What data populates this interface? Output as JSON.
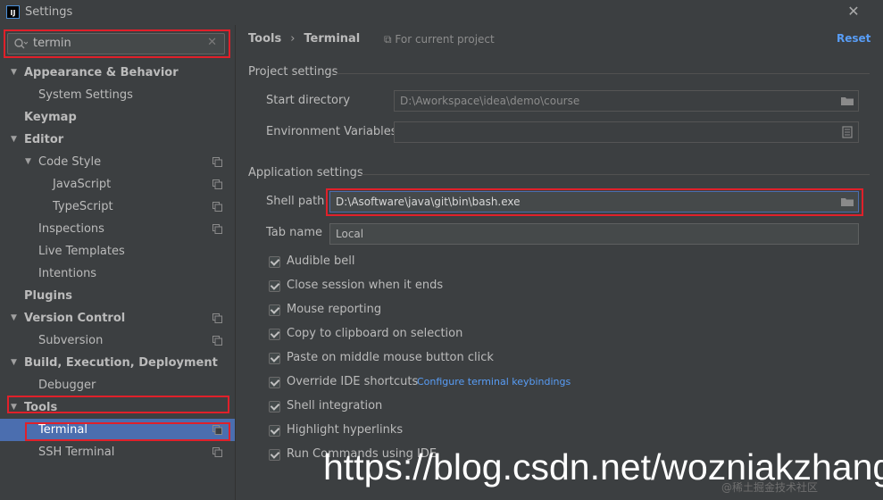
{
  "window": {
    "title": "Settings",
    "icon_text": "IJ"
  },
  "search": {
    "value": "termin",
    "placeholder": ""
  },
  "sidebar": {
    "items": [
      {
        "label": "Appearance & Behavior",
        "level": 0,
        "bold": true,
        "expanded": true
      },
      {
        "label": "System Settings",
        "level": 1,
        "bold": false
      },
      {
        "label": "Keymap",
        "level": 0,
        "bold": true
      },
      {
        "label": "Editor",
        "level": 0,
        "bold": true,
        "expanded": true
      },
      {
        "label": "Code Style",
        "level": 1,
        "bold": false,
        "expanded": true,
        "project_icon": true
      },
      {
        "label": "JavaScript",
        "level": 2,
        "bold": false,
        "project_icon": true
      },
      {
        "label": "TypeScript",
        "level": 2,
        "bold": false,
        "project_icon": true
      },
      {
        "label": "Inspections",
        "level": 1,
        "bold": false,
        "project_icon": true
      },
      {
        "label": "Live Templates",
        "level": 1,
        "bold": false
      },
      {
        "label": "Intentions",
        "level": 1,
        "bold": false
      },
      {
        "label": "Plugins",
        "level": 0,
        "bold": true
      },
      {
        "label": "Version Control",
        "level": 0,
        "bold": true,
        "expanded": true,
        "project_icon": true
      },
      {
        "label": "Subversion",
        "level": 1,
        "bold": false,
        "project_icon": true
      },
      {
        "label": "Build, Execution, Deployment",
        "level": 0,
        "bold": true,
        "expanded": true
      },
      {
        "label": "Debugger",
        "level": 1,
        "bold": false
      },
      {
        "label": "Tools",
        "level": 0,
        "bold": true,
        "expanded": true
      },
      {
        "label": "Terminal",
        "level": 1,
        "bold": false,
        "selected": true,
        "project_icon": true
      },
      {
        "label": "SSH Terminal",
        "level": 1,
        "bold": false,
        "project_icon": true
      }
    ]
  },
  "header": {
    "breadcrumb_parent": "Tools",
    "breadcrumb_separator": "›",
    "breadcrumb_current": "Terminal",
    "for_project": "For current project",
    "reset": "Reset"
  },
  "project_settings": {
    "title": "Project settings",
    "start_directory_label": "Start directory",
    "start_directory_value": "D:\\Aworkspace\\idea\\demo\\course",
    "env_vars_label": "Environment Variables",
    "env_vars_value": ""
  },
  "application_settings": {
    "title": "Application settings",
    "shell_path_label": "Shell path",
    "shell_path_value": "D:\\Asoftware\\java\\git\\bin\\bash.exe",
    "tab_name_label": "Tab name",
    "tab_name_value": "Local"
  },
  "checkboxes": [
    {
      "label": "Audible bell",
      "checked": true
    },
    {
      "label": "Close session when it ends",
      "checked": true
    },
    {
      "label": "Mouse reporting",
      "checked": true
    },
    {
      "label": "Copy to clipboard on selection",
      "checked": true
    },
    {
      "label": "Paste on middle mouse button click",
      "checked": true
    },
    {
      "label": "Override IDE shortcuts",
      "checked": true,
      "link": "Configure terminal keybindings"
    },
    {
      "label": "Shell integration",
      "checked": true
    },
    {
      "label": "Highlight hyperlinks",
      "checked": true
    },
    {
      "label": "Run Commands using IDE",
      "checked": true
    }
  ],
  "watermark": {
    "text": "https://blog.csdn.net/wozniakzhang",
    "small_text": "@稀土掘金技术社区"
  },
  "colors": {
    "accent_selection": "#4b6eaf",
    "link": "#589df6",
    "highlight_box": "#e0202a",
    "background": "#3c3f41"
  }
}
